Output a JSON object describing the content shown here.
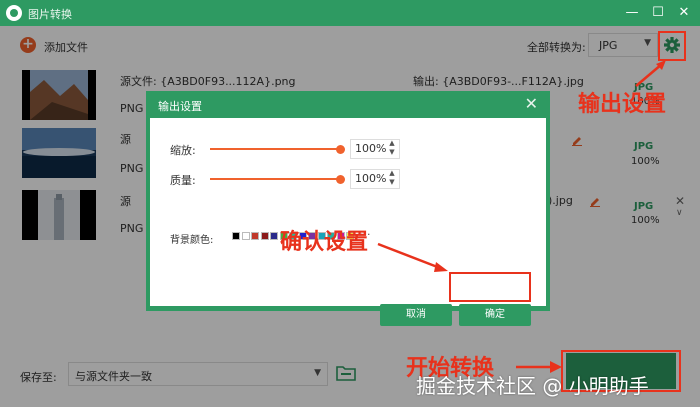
{
  "window": {
    "title": "图片转换",
    "controls": [
      "minimize",
      "maximize",
      "close"
    ]
  },
  "toolbar": {
    "add_label": "添加文件",
    "convert_all_label": "全部转换为:",
    "format_value": "JPG"
  },
  "files": [
    {
      "src": "源文件: {A3BD0F93...112A}.png",
      "src_format": "PNG",
      "out": "输出: {A3BD0F93-...F112A}.jpg",
      "out_format": "JPG",
      "quality": "100%"
    },
    {
      "src": "源",
      "src_format": "PNG",
      "out": "",
      "out_format": "JPG",
      "quality": "100%"
    },
    {
      "src": "源",
      "src_format": "PNG",
      "out": ").jpg",
      "out_format": "JPG",
      "quality": "100%"
    }
  ],
  "dialog": {
    "title": "输出设置",
    "scale_label": "缩放:",
    "scale_value": "100%",
    "quality_label": "质量:",
    "quality_value": "100%",
    "bg_label": "背景颜色:",
    "more": "···",
    "cancel": "取消",
    "confirm": "确定"
  },
  "swatches": [
    "#000000",
    "#ffffff",
    "#c0392b",
    "#8b1a1a",
    "#2a2a8a",
    "#3fb53f",
    "#1cc2a0",
    "#1f1fcc",
    "#7a2fa0",
    "#1aa3b8",
    "#23b0a0",
    "#c7199b",
    "#f2f24a"
  ],
  "bottom": {
    "save_label": "保存至:",
    "save_path": "与源文件夹一致",
    "start_label": "开始转换"
  },
  "annotations": {
    "output_settings": "输出设置",
    "confirm_settings": "确认设置",
    "start_convert": "开始转换"
  },
  "watermark": "掘金技术社区 @ 小明助手",
  "colors": {
    "primary": "#2e9a62",
    "accent": "#f0622d",
    "annotation": "#e8321c"
  }
}
